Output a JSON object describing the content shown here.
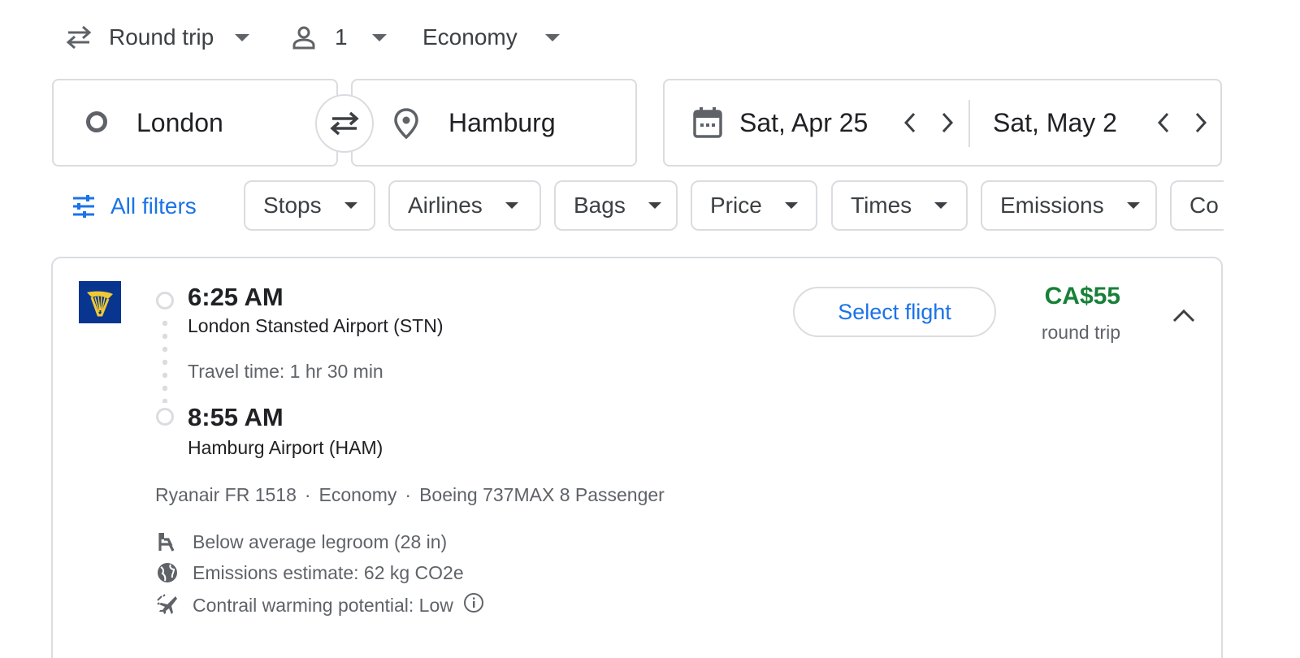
{
  "search_options": {
    "trip_type": "Round trip",
    "passengers": "1",
    "cabin_class": "Economy"
  },
  "search": {
    "origin": "London",
    "destination": "Hamburg",
    "departure_date": "Sat, Apr 25",
    "return_date": "Sat, May 2"
  },
  "filters": {
    "all_filters_label": "All filters",
    "chips": [
      "Stops",
      "Airlines",
      "Bags",
      "Price",
      "Times",
      "Emissions",
      "Co"
    ]
  },
  "flight": {
    "airline_logo": "ryanair-harp-logo",
    "departure_time": "6:25 AM",
    "departure_airport": "London Stansted Airport (STN)",
    "travel_time": "Travel time: 1 hr 30 min",
    "arrival_time": "8:55 AM",
    "arrival_airport": "Hamburg Airport (HAM)",
    "select_label": "Select flight",
    "price": "CA$55",
    "price_subtitle": "round trip",
    "details": [
      "Ryanair FR 1518",
      "Economy",
      "Boeing 737MAX 8 Passenger"
    ],
    "details_separator": "·",
    "amenities": {
      "legroom": "Below average legroom (28 in)",
      "emissions": "Emissions estimate: 62 kg CO2e",
      "contrail": "Contrail warming potential: Low"
    }
  },
  "colors": {
    "accent_blue": "#1a73e8",
    "price_green": "#188038",
    "border_gray": "#dadce0",
    "ryanair_blue": "#073590",
    "ryanair_yellow": "#f1c933"
  }
}
